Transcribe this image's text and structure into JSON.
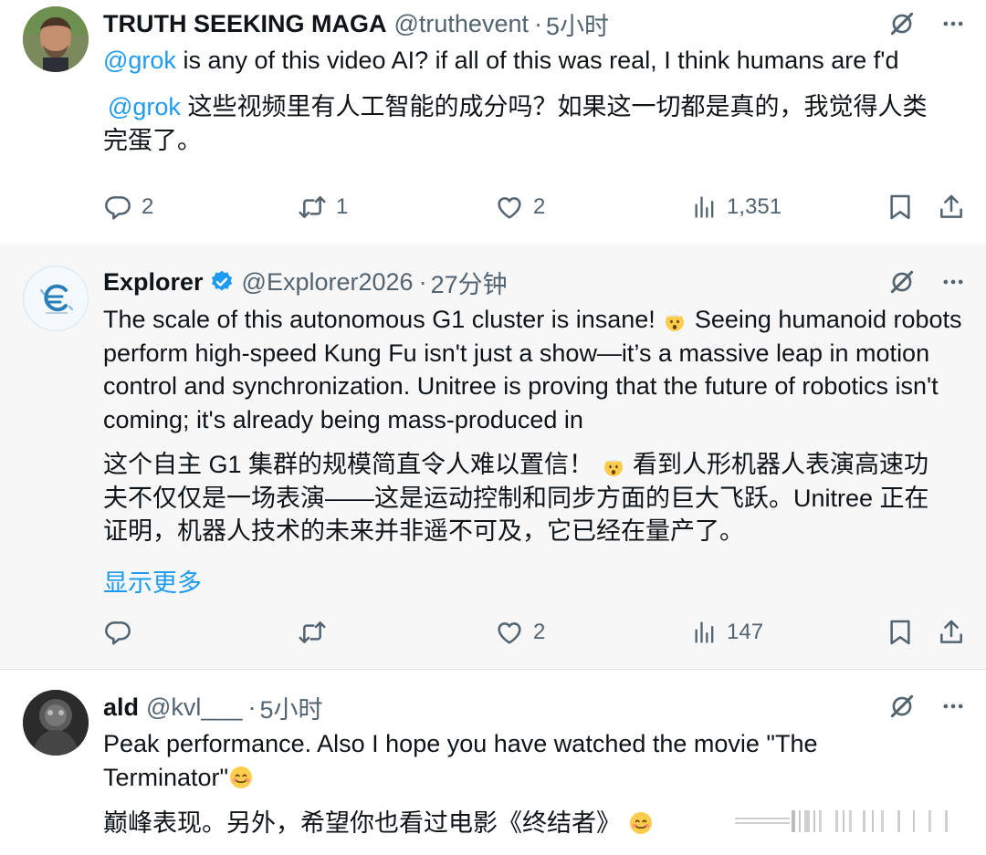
{
  "posts": [
    {
      "name": "TRUTH SEEKING MAGA",
      "handle": "@truthevent",
      "dot": "·",
      "time": "5小时",
      "mention": "@grok",
      "text_en_rest": " is any of this video AI? if all of this was real, I think humans are f'd",
      "text_zh_mention": "@grok",
      "text_zh_rest": " 这些视频里有人工智能的成分吗？如果这一切都是真的，我觉得人类完蛋了。",
      "replies": "2",
      "reposts": "1",
      "likes": "2",
      "views": "1,351"
    },
    {
      "name": "Explorer",
      "handle": "@Explorer2026",
      "dot": "·",
      "time": "27分钟",
      "text_en_1": "The scale of this autonomous G1 cluster is insane! ",
      "text_en_2": " Seeing humanoid robots perform high-speed Kung Fu isn't just a show—it’s a massive leap in motion control and synchronization. Unitree is proving that the future of robotics isn't coming; it's already being mass-produced in",
      "text_zh_1": "这个自主 G1 集群的规模简直令人难以置信！ ",
      "text_zh_2": " 看到人形机器人表演高速功夫不仅仅是一场表演——这是运动控制和同步方面的巨大飞跃。Unitree 正在证明，机器人技术的未来并非遥不可及，它已经在量产了。",
      "show_more": "显示更多",
      "replies": "",
      "reposts": "",
      "likes": "2",
      "views": "147"
    },
    {
      "name": "ald",
      "handle": "@kvl___",
      "dot": "·",
      "time": "5小时",
      "text_en": "Peak performance. Also I hope you have watched the movie \"The Terminator\"",
      "text_zh": "巅峰表现。另外，希望你也看过电影《终结者》 "
    }
  ],
  "colors": {
    "accent": "#1d9bf0",
    "secondary_text": "#536471",
    "highlight_bg": "#f7f7f7"
  },
  "icons": [
    "grok-icon",
    "more-icon",
    "reply-icon",
    "repost-icon",
    "like-icon",
    "views-icon",
    "bookmark-icon",
    "share-icon",
    "verified-badge-icon",
    "exploding-head-emoji",
    "smiling-emoji"
  ]
}
